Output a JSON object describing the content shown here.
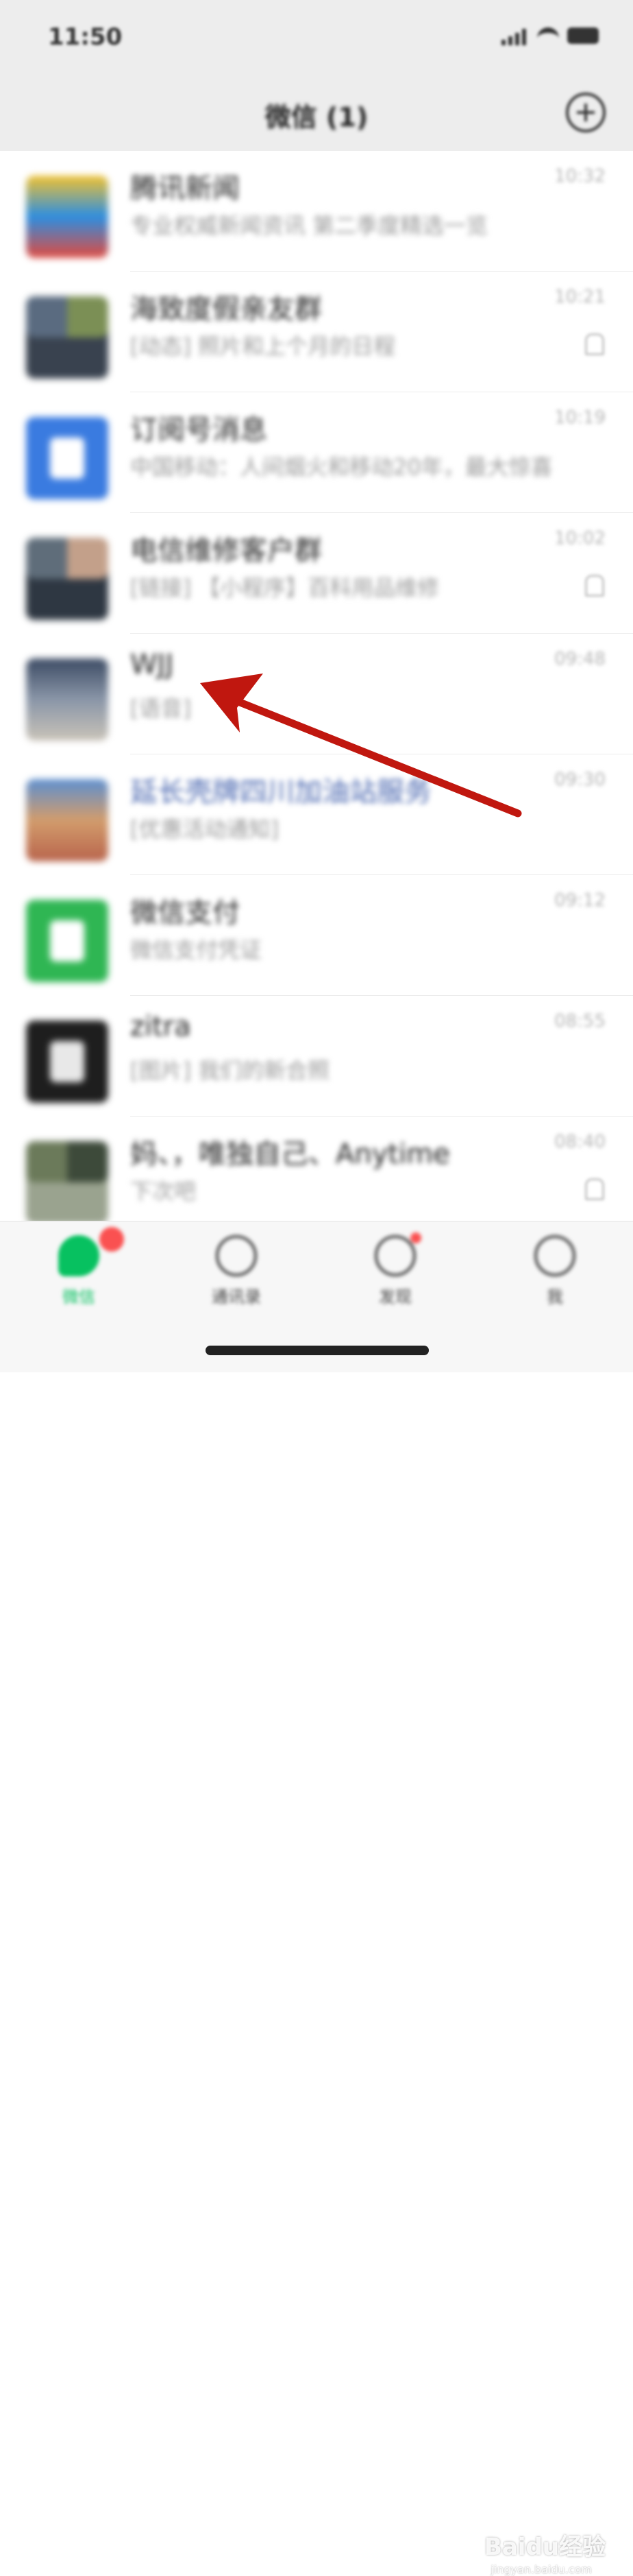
{
  "status_bar": {
    "time": "11:50"
  },
  "header": {
    "title": "微信 (1)"
  },
  "chats": [
    {
      "name": "腾讯新闻",
      "preview": "专业权威新闻资讯 第二季度精选一览",
      "time": "10:32",
      "avatar_colors": [
        "#f2c230",
        "#2d8ee0",
        "#e04a3f"
      ],
      "name_style": "normal",
      "muted": false
    },
    {
      "name": "海致度假亲友群",
      "preview": "[动态] 照片和上个月的日程",
      "time": "10:21",
      "avatar_colors": [
        "#5a6b80",
        "#7b8f55",
        "#39424f",
        "#8b7d6e"
      ],
      "name_style": "normal",
      "muted": true
    },
    {
      "name": "订阅号消息",
      "preview": "中国移动：人间烟火和移动20年，最大惊喜",
      "time": "10:19",
      "avatar_colors": [
        "#3a7be0",
        "#ffffff"
      ],
      "name_style": "normal",
      "muted": false
    },
    {
      "name": "电信维修客户群",
      "preview": "[链接] 【小程序】百科用品维修",
      "time": "10:02",
      "avatar_colors": [
        "#5f6d7a",
        "#c3a08a",
        "#2e3742",
        "#7f97ae"
      ],
      "name_style": "normal",
      "muted": true
    },
    {
      "name": "WJJ",
      "preview": "[语音]",
      "time": "09:48",
      "avatar_colors": [
        "#3b4a63",
        "#8a96a8",
        "#c9c3b8"
      ],
      "name_style": "normal",
      "muted": false
    },
    {
      "name": "延长壳牌四川加油站服务",
      "preview": "[优惠活动通知]",
      "time": "09:30",
      "avatar_colors": [
        "#5c8fd0",
        "#d29c6c",
        "#b8644c"
      ],
      "name_style": "blue",
      "muted": false
    },
    {
      "name": "微信支付",
      "preview": "微信支付凭证",
      "time": "09:12",
      "avatar_colors": [
        "#2fb653",
        "#ffffff"
      ],
      "name_style": "normal",
      "muted": false
    },
    {
      "name": "zitra",
      "preview": "[图片] 我们的新合照",
      "time": "08:55",
      "avatar_colors": [
        "#1e1e1e",
        "#e8e8e8"
      ],
      "name_style": "normal",
      "muted": false
    },
    {
      "name": "妈、，唯独自己、Anytime",
      "preview": "下次吧",
      "time": "08:40",
      "avatar_colors": [
        "#6b7a5a",
        "#3d4a3a",
        "#9aa38f",
        "#2f3540"
      ],
      "name_style": "normal",
      "muted": true
    }
  ],
  "tabs": [
    {
      "label": "微信",
      "icon": "chat-bubble-icon",
      "active": true
    },
    {
      "label": "通讯录",
      "icon": "contacts-icon",
      "active": false
    },
    {
      "label": "发现",
      "icon": "compass-icon",
      "active": false
    },
    {
      "label": "我",
      "icon": "person-icon",
      "active": false
    }
  ],
  "watermark": {
    "brand": "Baidu经验",
    "url": "jingyan.baidu.com"
  },
  "annotation": {
    "color": "#c0170f"
  }
}
